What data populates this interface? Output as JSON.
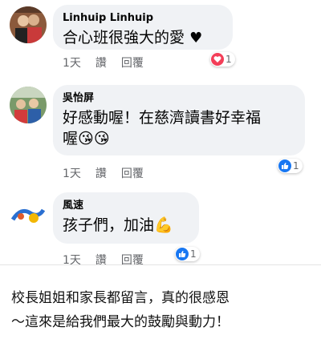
{
  "comments": [
    {
      "author": "Linhuip Linhuip",
      "text": "合心班很強大的愛",
      "heart": "♥",
      "time": "1天",
      "like": "讚",
      "reply": "回覆",
      "reaction_count": "1",
      "reaction_icon": "love-reaction-icon",
      "reaction_color": "#f33e58"
    },
    {
      "author": "吳怡屏",
      "text": "好感動喔！在慈濟讀書好幸福",
      "text2": "喔",
      "emoji": "😘😘",
      "time": "1天",
      "like": "讚",
      "reply": "回覆",
      "reaction_count": "1",
      "reaction_icon": "like-reaction-icon",
      "reaction_color": "#1877f2"
    },
    {
      "author": "風速",
      "text": "孩子們，加油",
      "emoji": "💪",
      "time": "1天",
      "like": "讚",
      "reply": "回覆",
      "reaction_count": "1",
      "reaction_icon": "like-reaction-icon",
      "reaction_color": "#1877f2"
    }
  ],
  "caption": {
    "line1": "校長姐姐和家長都留言，真的很感恩",
    "line2": "～這來是給我們最大的鼓勵與動力！"
  }
}
